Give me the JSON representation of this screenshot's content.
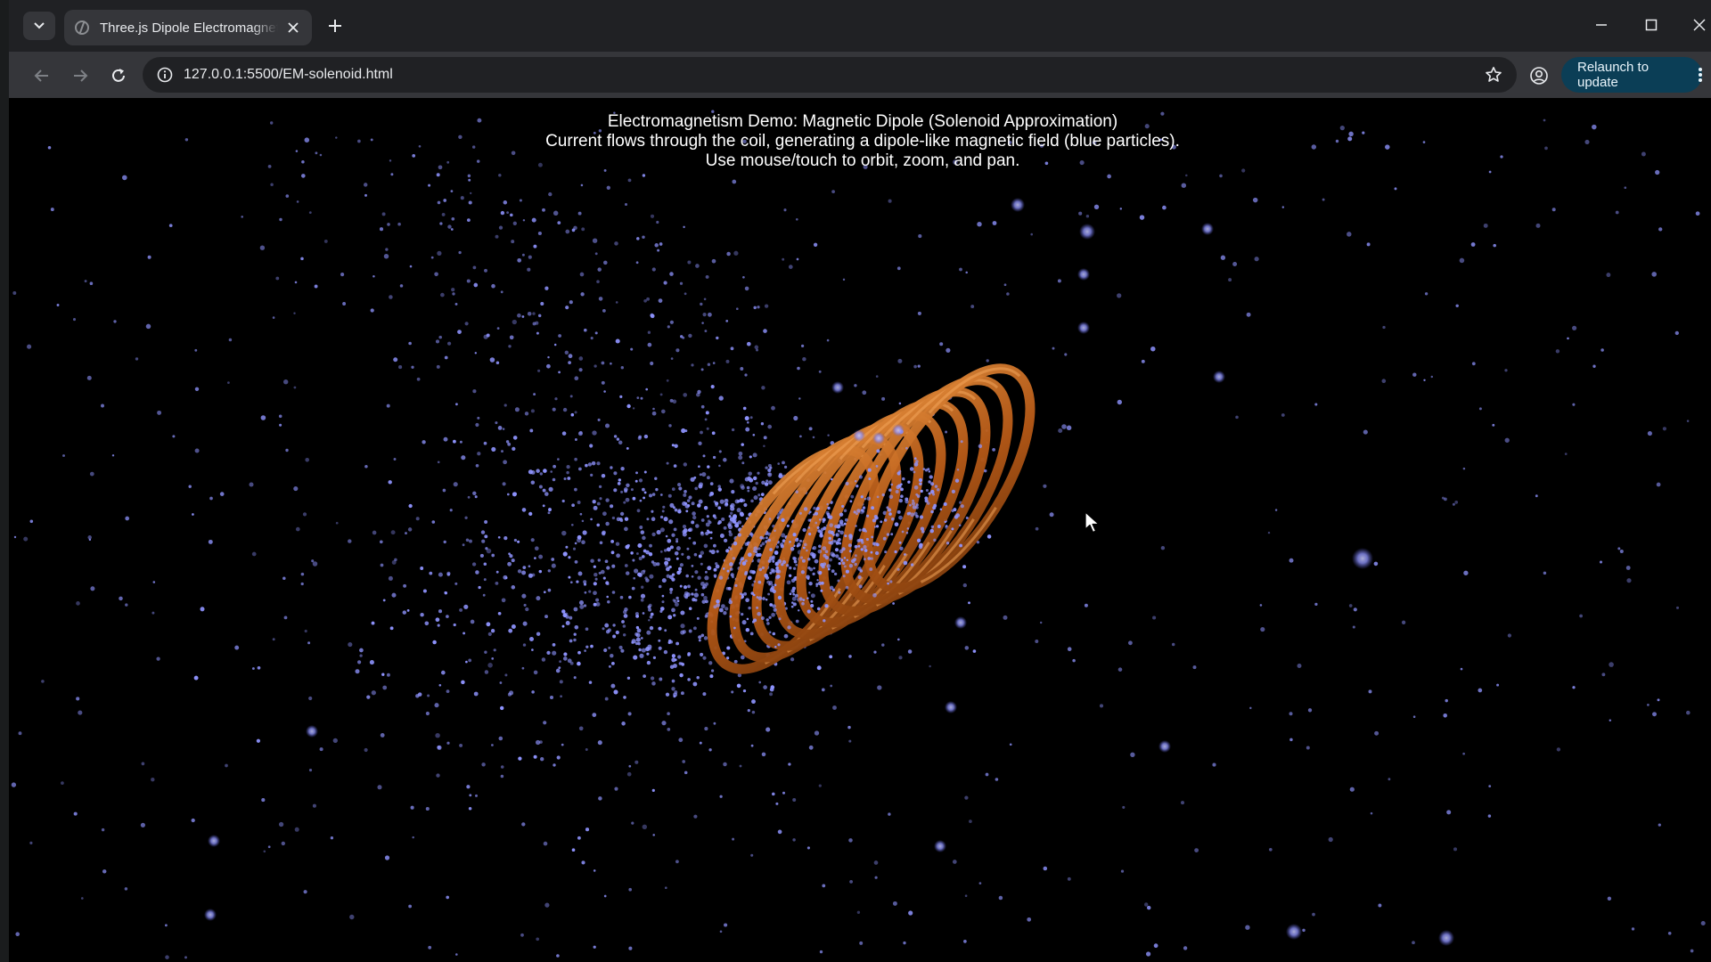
{
  "browser": {
    "tab": {
      "title": "Three.js Dipole Electromagnetism Demo"
    },
    "address_bar": {
      "url": "127.0.0.1:5500/EM-solenoid.html"
    },
    "relaunch_label": "Relaunch to update"
  },
  "page": {
    "info_lines": [
      "Electromagnetism Demo: Magnetic Dipole (Solenoid Approximation)",
      "Current flows through the coil, generating a dipole-like magnetic field (blue particles).",
      "Use mouse/touch to orbit, zoom, and pan."
    ],
    "scene": {
      "coil_color": "#c4661d",
      "particle_color": "#8f94ff",
      "background": "#000000",
      "coil_turns": 8
    }
  },
  "icons": {
    "tab_search": "chevron-down-icon",
    "favicon": "globe-icon",
    "tab_close": "close-icon",
    "new_tab": "plus-icon",
    "back": "arrow-left-icon",
    "forward": "arrow-right-icon",
    "reload": "reload-icon",
    "site_info": "info-icon",
    "bookmark": "star-icon",
    "profile": "profile-icon",
    "menu": "more-vertical-icon",
    "minimize": "minimize-icon",
    "maximize": "maximize-icon",
    "close_window": "close-window-icon",
    "cursor": "mouse-pointer-icon"
  }
}
